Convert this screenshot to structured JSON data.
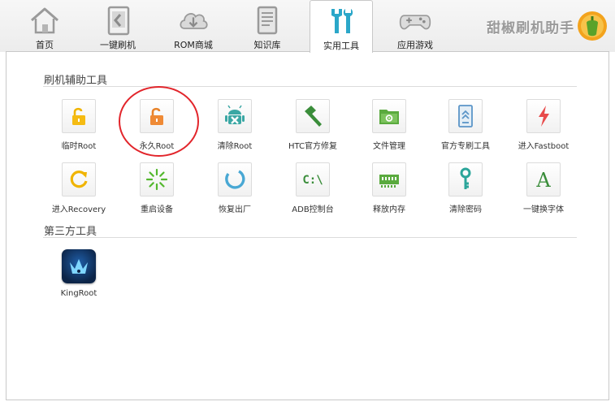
{
  "brand": {
    "name": "甜椒刷机助手",
    "accent": "#e87722"
  },
  "nav": {
    "tabs": [
      {
        "label": "首页",
        "icon": "home-icon"
      },
      {
        "label": "一键刷机",
        "icon": "flash-icon"
      },
      {
        "label": "ROM商城",
        "icon": "cloud-download-icon"
      },
      {
        "label": "知识库",
        "icon": "document-icon"
      },
      {
        "label": "实用工具",
        "icon": "tools-icon",
        "active": true
      },
      {
        "label": "应用游戏",
        "icon": "gamepad-icon"
      }
    ]
  },
  "sections": {
    "flash_tools": {
      "title": "刷机辅助工具",
      "items": [
        {
          "label": "临时Root",
          "icon": "lock-open-icon"
        },
        {
          "label": "永久Root",
          "icon": "lock-open-orange-icon"
        },
        {
          "label": "清除Root",
          "icon": "android-icon"
        },
        {
          "label": "HTC官方修复",
          "icon": "hammer-icon"
        },
        {
          "label": "文件管理",
          "icon": "folder-gear-icon"
        },
        {
          "label": "官方专刷工具",
          "icon": "tablet-icon"
        },
        {
          "label": "进入Fastboot",
          "icon": "lightning-icon"
        },
        {
          "label": "进入Recovery",
          "icon": "refresh-icon"
        },
        {
          "label": "重启设备",
          "icon": "loading-spinner-icon"
        },
        {
          "label": "恢复出厂",
          "icon": "reset-circle-icon"
        },
        {
          "label": "ADB控制台",
          "icon": "console-icon"
        },
        {
          "label": "释放内存",
          "icon": "memory-icon"
        },
        {
          "label": "清除密码",
          "icon": "key-icon"
        },
        {
          "label": "一键换字体",
          "icon": "font-icon"
        }
      ]
    },
    "third_party": {
      "title": "第三方工具",
      "items": [
        {
          "label": "KingRoot",
          "icon": "crown-icon"
        }
      ]
    }
  },
  "annotation": {
    "highlighted_item": "永久Root",
    "color": "#e2252b"
  }
}
